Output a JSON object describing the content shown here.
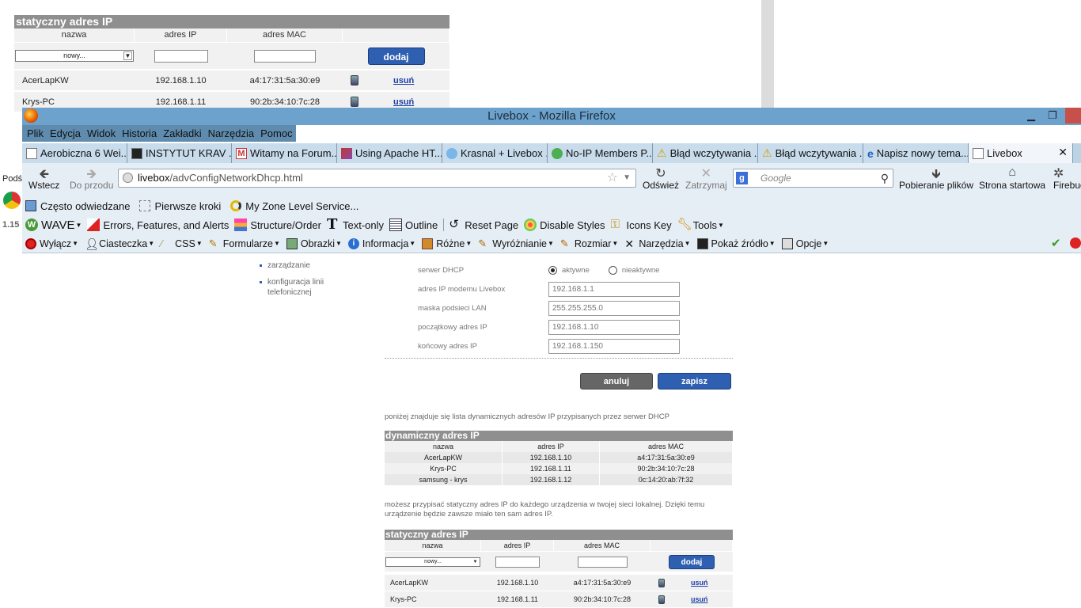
{
  "background_page": {
    "static_table": {
      "title": "statyczny adres IP",
      "columns": [
        "nazwa",
        "adres IP",
        "adres MAC"
      ],
      "new_option": "nowy...",
      "add_label": "dodaj",
      "rows": [
        {
          "name": "AcerLapKW",
          "ip": "192.168.1.10",
          "mac": "a4:17:31:5a:30:e9",
          "delete": "usuń"
        },
        {
          "name": "Krys-PC",
          "ip": "192.168.1.11",
          "mac": "90:2b:34:10:7c:28",
          "delete": "usuń"
        }
      ]
    },
    "left_strip": {
      "text1": "Podś",
      "text2": "1.15"
    }
  },
  "window": {
    "title": "Livebox - Mozilla Firefox",
    "menu": [
      "Plik",
      "Edycja",
      "Widok",
      "Historia",
      "Zakładki",
      "Narzędzia",
      "Pomoc"
    ],
    "tabs": [
      {
        "label": "Aerobiczna 6 Wei..."
      },
      {
        "label": "INSTYTUT KRAV ..."
      },
      {
        "label": "Witamy na Forum..."
      },
      {
        "label": "Using Apache HT..."
      },
      {
        "label": "Krasnal + Livebox ..."
      },
      {
        "label": "No-IP Members P..."
      },
      {
        "label": "Błąd wczytywania ..."
      },
      {
        "label": "Błąd wczytywania ..."
      },
      {
        "label": "Napisz nowy tema..."
      },
      {
        "label": "Livebox"
      }
    ],
    "nav": {
      "back": "Wstecz",
      "forward": "Do przodu",
      "refresh": "Odśwież",
      "stop": "Zatrzymaj",
      "downloads": "Pobieranie plików",
      "home": "Strona startowa",
      "firebug": "Firebug"
    },
    "url": {
      "host": "livebox",
      "path": "/advConfigNetworkDhcp.html"
    },
    "search": {
      "placeholder": "Google"
    },
    "bookmarks": [
      "Często odwiedzane",
      "Pierwsze kroki",
      "My Zone Level Service..."
    ],
    "wave_toolbar": [
      "WAVE",
      "Errors, Features, and Alerts",
      "Structure/Order",
      "Text-only",
      "Outline",
      "Reset Page",
      "Disable Styles",
      "Icons Key",
      "Tools"
    ],
    "dev_toolbar": [
      "Wyłącz",
      "Ciasteczka",
      "CSS",
      "Formularze",
      "Obrazki",
      "Informacja",
      "Różne",
      "Wyróżnianie",
      "Rozmiar",
      "Narzędzia",
      "Pokaż źródło",
      "Opcje"
    ]
  },
  "content": {
    "sidenav": [
      "zarządzanie",
      "konfiguracja linii telefonicznej"
    ],
    "form": {
      "dhcp_label": "serwer DHCP",
      "active": "aktywne",
      "inactive": "nieaktywne",
      "modem_ip_label": "adres IP modemu Livebox",
      "modem_ip": "192.168.1.1",
      "mask_label": "maska podsieci LAN",
      "mask": "255.255.255.0",
      "start_ip_label": "początkowy adres IP",
      "start_ip": "192.168.1.10",
      "end_ip_label": "końcowy adres IP",
      "end_ip": "192.168.1.150"
    },
    "cancel_label": "anuluj",
    "save_label": "zapisz",
    "dynamic_info": "poniżej znajduje się lista dynamicznych adresów IP przypisanych przez serwer DHCP",
    "dynamic_table": {
      "title": "dynamiczny adres IP",
      "columns": [
        "nazwa",
        "adres IP",
        "adres MAC"
      ],
      "rows": [
        {
          "name": "AcerLapKW",
          "ip": "192.168.1.10",
          "mac": "a4:17:31:5a:30:e9"
        },
        {
          "name": "Krys-PC",
          "ip": "192.168.1.11",
          "mac": "90:2b:34:10:7c:28"
        },
        {
          "name": "samsung - krys",
          "ip": "192.168.1.12",
          "mac": "0c:14:20:ab:7f:32"
        }
      ]
    },
    "static_info": "możesz przypisać statyczny adres IP do każdego urządzenia w twojej sieci lokalnej. Dzięki temu urządzenie będzie zawsze miało ten sam adres IP.",
    "static_table": {
      "title": "statyczny adres IP",
      "columns": [
        "nazwa",
        "adres IP",
        "adres MAC"
      ],
      "new_option": "nowy...",
      "add_label": "dodaj",
      "rows": [
        {
          "name": "AcerLapKW",
          "ip": "192.168.1.10",
          "mac": "a4:17:31:5a:30:e9",
          "delete": "usuń"
        },
        {
          "name": "Krys-PC",
          "ip": "192.168.1.11",
          "mac": "90:2b:34:10:7c:28",
          "delete": "usuń"
        }
      ]
    }
  }
}
